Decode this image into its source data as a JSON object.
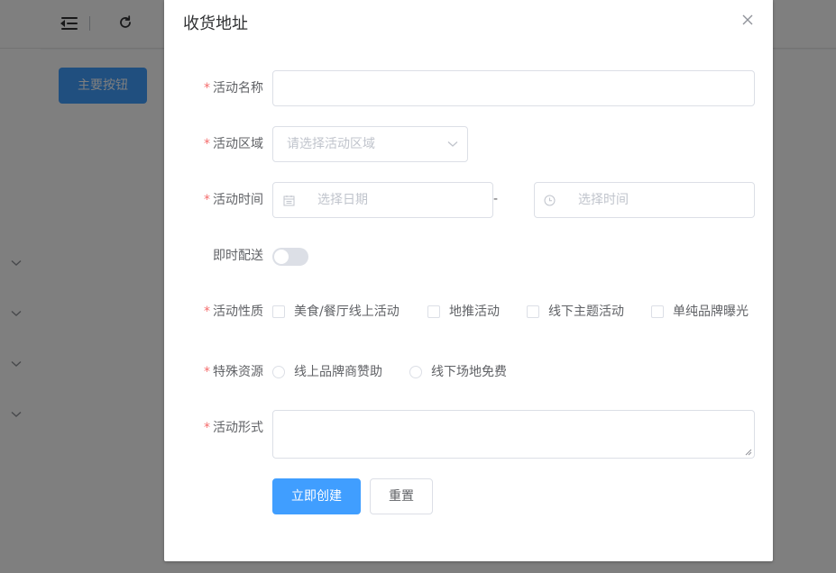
{
  "app": {
    "primary_button_label": "主要按钮",
    "icons": {
      "menu": "menu-fold-icon",
      "refresh": "refresh-icon",
      "sidebar_chevron": "chevron-down-icon"
    }
  },
  "dialog": {
    "title": "收货地址",
    "fields": {
      "activity_name": {
        "label": "活动名称",
        "required_mark": "*",
        "value": ""
      },
      "region": {
        "label": "活动区域",
        "required_mark": "*",
        "placeholder": "请选择活动区域"
      },
      "time": {
        "label": "活动时间",
        "required_mark": "*",
        "date_placeholder": "选择日期",
        "range_separator": "-",
        "time_placeholder": "选择时间"
      },
      "instant_delivery": {
        "label": "即时配送",
        "on": false
      },
      "nature": {
        "label": "活动性质",
        "required_mark": "*",
        "options": [
          "美食/餐厅线上活动",
          "地推活动",
          "线下主题活动",
          "单纯品牌曝光"
        ]
      },
      "resources": {
        "label": "特殊资源",
        "required_mark": "*",
        "options": [
          "线上品牌商赞助",
          "线下场地免费"
        ]
      },
      "form": {
        "label": "活动形式",
        "required_mark": "*",
        "value": ""
      }
    },
    "buttons": {
      "create": "立即创建",
      "reset": "重置"
    }
  },
  "colors": {
    "primary": "#409eff",
    "required": "#f56c6c",
    "border": "#dcdfe6",
    "placeholder": "#c0c4cc",
    "text": "#606266"
  }
}
